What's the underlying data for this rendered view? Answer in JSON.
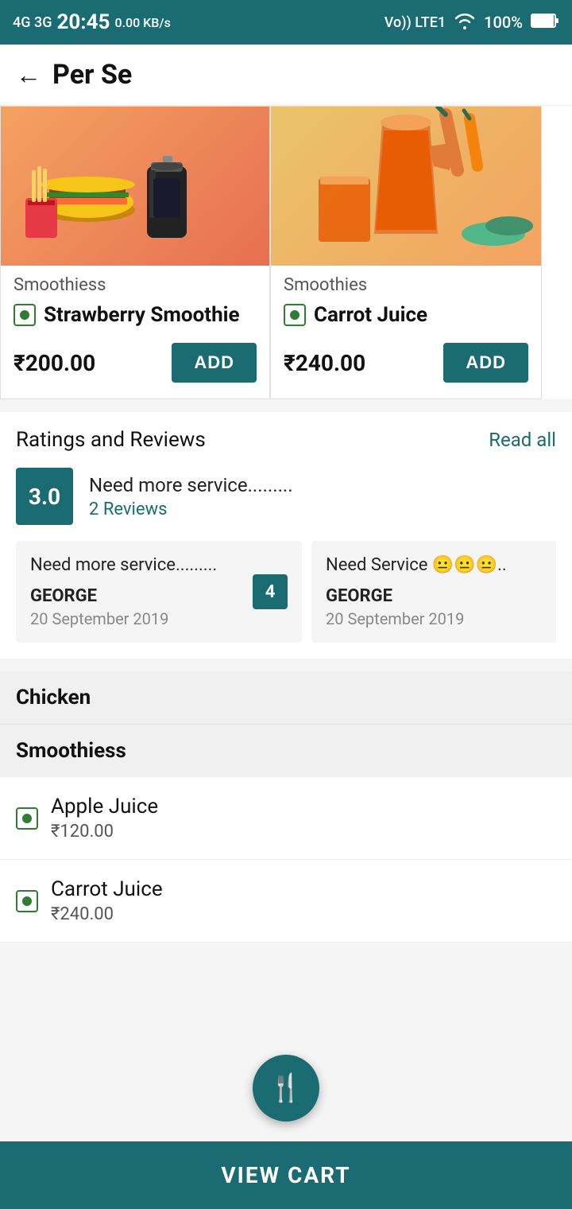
{
  "statusBar": {
    "time": "20:45",
    "network": "4G 3G",
    "speed": "0.00 KB/s",
    "signal": "Vo)) LTE1",
    "wifi": "WiFi",
    "battery": "100%"
  },
  "header": {
    "title": "Per Se",
    "backLabel": "←"
  },
  "products": [
    {
      "id": "strawberry-smoothie",
      "category": "Smoothiess",
      "name": "Strawberry Smoothie",
      "price": "₹200.00",
      "addLabel": "ADD",
      "emoji": "🍔🍟🥤"
    },
    {
      "id": "carrot-juice",
      "category": "Smoothies",
      "name": "Carrot Juice",
      "price": "₹240.00",
      "addLabel": "ADD",
      "emoji": "🥕🧃"
    }
  ],
  "ratings": {
    "sectionTitle": "Ratings and Reviews",
    "readAllLabel": "Read all",
    "score": "3.0",
    "summaryComment": "Need more service.........",
    "reviewCount": "2 Reviews",
    "reviews": [
      {
        "comment": "Need more service.........",
        "author": "GEORGE",
        "date": "20 September 2019",
        "number": "4"
      },
      {
        "comment": "Need Service 😐😐😐..",
        "author": "GEORGE",
        "date": "20 September 2019",
        "number": null
      }
    ]
  },
  "sections": [
    {
      "id": "chicken",
      "title": "Chicken"
    },
    {
      "id": "smoothiess",
      "title": "Smoothiess"
    }
  ],
  "menuItems": [
    {
      "id": "apple-juice",
      "name": "Apple Juice",
      "price": "₹120.00"
    },
    {
      "id": "carrot-juice-menu",
      "name": "Carrot Juice",
      "price": "₹240.00"
    }
  ],
  "fab": {
    "icon": "🍴"
  },
  "viewCart": {
    "label": "VIEW CART"
  }
}
